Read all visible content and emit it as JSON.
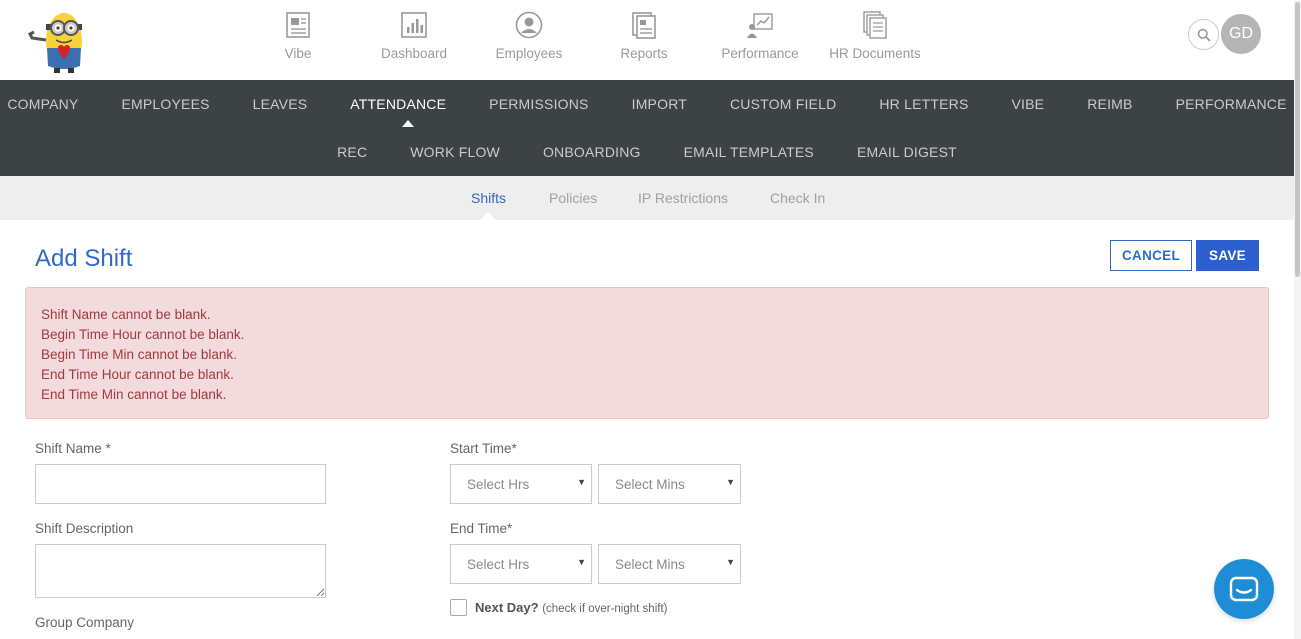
{
  "topnav": {
    "items": [
      {
        "label": "Vibe",
        "icon": "vibe-icon"
      },
      {
        "label": "Dashboard",
        "icon": "dashboard-icon"
      },
      {
        "label": "Employees",
        "icon": "employees-icon"
      },
      {
        "label": "Reports",
        "icon": "reports-icon"
      },
      {
        "label": "Performance",
        "icon": "performance-icon"
      },
      {
        "label": "HR Documents",
        "icon": "hr-documents-icon"
      }
    ],
    "avatar_initials": "GD"
  },
  "main_menu": {
    "row1": [
      "COMPANY",
      "EMPLOYEES",
      "LEAVES",
      "ATTENDANCE",
      "PERMISSIONS",
      "IMPORT",
      "CUSTOM FIELD",
      "HR LETTERS",
      "VIBE",
      "REIMB",
      "PERFORMANCE"
    ],
    "row2": [
      "REC",
      "WORK FLOW",
      "ONBOARDING",
      "EMAIL TEMPLATES",
      "EMAIL DIGEST"
    ],
    "active": "ATTENDANCE"
  },
  "subtabs": {
    "items": [
      "Shifts",
      "Policies",
      "IP Restrictions",
      "Check In"
    ],
    "active": "Shifts"
  },
  "page": {
    "title": "Add Shift",
    "cancel_label": "CANCEL",
    "save_label": "SAVE"
  },
  "alert": {
    "messages": [
      "Shift Name cannot be blank.",
      "Begin Time Hour cannot be blank.",
      "Begin Time Min cannot be blank.",
      "End Time Hour cannot be blank.",
      "End Time Min cannot be blank."
    ]
  },
  "form": {
    "shift_name_label": "Shift Name *",
    "shift_name_value": "",
    "shift_description_label": "Shift Description",
    "shift_description_value": "",
    "group_company_label": "Group Company",
    "start_time_label": "Start Time*",
    "end_time_label": "End Time*",
    "select_hrs": "Select Hrs",
    "select_mins": "Select Mins",
    "next_day_label": "Next Day?",
    "next_day_hint": "(check if over-night shift)",
    "next_day_checked": false
  },
  "colors": {
    "accent": "#2e6bc6",
    "menu_bg": "#3d4245",
    "alert_bg": "#f2dadd",
    "alert_text": "#a33a3c",
    "chat": "#1f8dd6"
  }
}
